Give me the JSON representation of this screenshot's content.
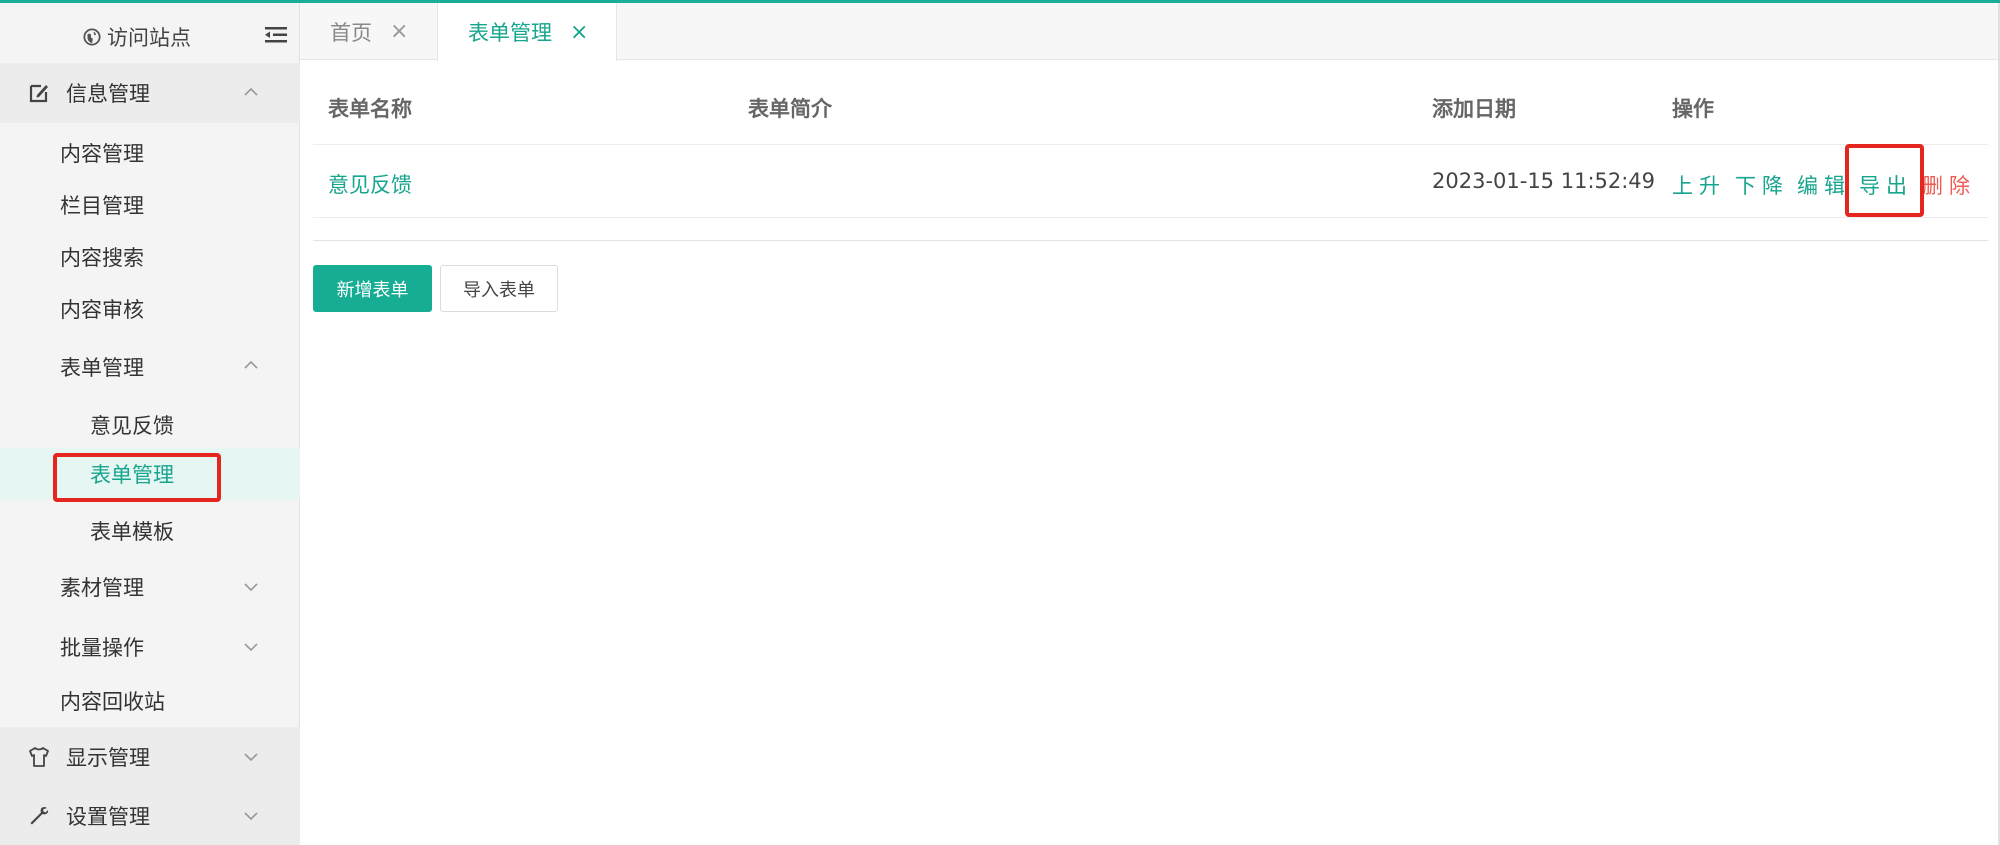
{
  "sidebar": {
    "visit_site": "访问站点",
    "sections": [
      {
        "label": "信息管理",
        "icon": "edit-icon"
      },
      {
        "label": "显示管理",
        "icon": "shirt-icon"
      },
      {
        "label": "设置管理",
        "icon": "wrench-icon"
      }
    ],
    "items": [
      {
        "label": "内容管理"
      },
      {
        "label": "栏目管理"
      },
      {
        "label": "内容搜索"
      },
      {
        "label": "内容审核"
      },
      {
        "label": "表单管理"
      },
      {
        "label": "意见反馈"
      },
      {
        "label": "表单管理"
      },
      {
        "label": "表单模板"
      },
      {
        "label": "素材管理"
      },
      {
        "label": "批量操作"
      },
      {
        "label": "内容回收站"
      }
    ]
  },
  "tabs": [
    {
      "label": "首页",
      "close": "×"
    },
    {
      "label": "表单管理",
      "close": "×"
    }
  ],
  "table": {
    "headers": [
      "表单名称",
      "表单简介",
      "添加日期",
      "操作"
    ],
    "rows": [
      {
        "name": "意见反馈",
        "intro": "",
        "date": "2023-01-15 11:52:49",
        "actions": [
          "上升",
          "下降",
          "编辑",
          "导出",
          "删除"
        ]
      }
    ]
  },
  "buttons": {
    "add": "新增表单",
    "import": "导入表单"
  },
  "colors": {
    "accent": "#17a58e",
    "danger": "#ef5b52",
    "highlight": "#e5261f"
  }
}
